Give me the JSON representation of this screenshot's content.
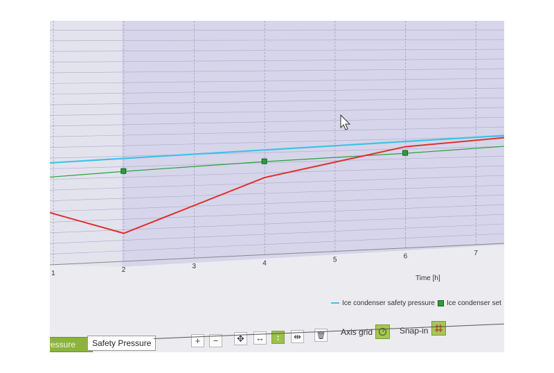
{
  "chart_data": {
    "type": "line",
    "xlabel": "Time [h]",
    "x_ticks": [
      "1",
      "2",
      "3",
      "4",
      "5",
      "6",
      "7"
    ],
    "xlim": [
      0.95,
      7.4
    ],
    "ylim": [
      0,
      10
    ],
    "series": [
      {
        "name": "Ice condenser safety pressure",
        "color": "#3cc3e8",
        "x": [
          0.95,
          7.4
        ],
        "y": [
          4.3,
          5.0
        ]
      },
      {
        "name": "Ice condenser setpoint",
        "color": "#2c9e3c",
        "markers": true,
        "x": [
          0.95,
          2,
          4,
          6,
          7.4
        ],
        "y": [
          3.7,
          3.85,
          4.1,
          4.3,
          4.5
        ]
      },
      {
        "color": "#e0302b",
        "x": [
          0.95,
          2,
          4,
          6,
          7.4
        ],
        "y": [
          2.2,
          1.2,
          3.4,
          4.6,
          4.9
        ]
      }
    ]
  },
  "legend": {
    "item1": "Ice condenser safety pressure",
    "item2": "Ice condenser set"
  },
  "tabs": {
    "active": "ressure",
    "inactive": "Safety Pressure"
  },
  "toolbar": {
    "zoom_in": "+",
    "zoom_out": "−",
    "pan_all": "✥",
    "pan_h": "↔",
    "pan_v": "↕",
    "fit": "⇹",
    "delete": "🗑",
    "axis_grid_label": "Axis grid",
    "snap_label": "Snap-in",
    "colors": {
      "active": "#9cc04c"
    }
  }
}
